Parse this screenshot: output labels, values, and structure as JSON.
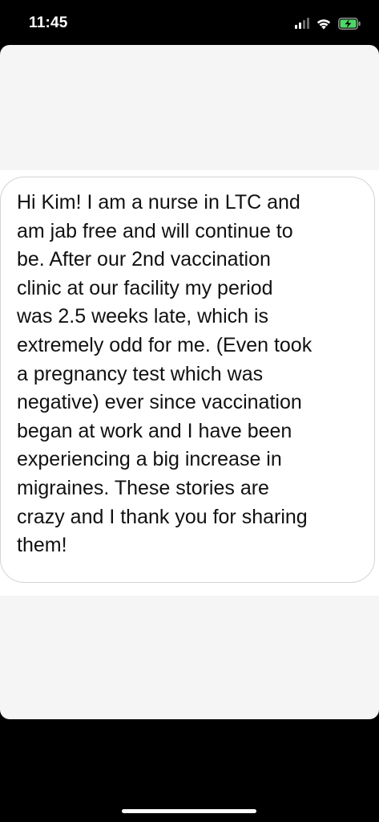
{
  "status_bar": {
    "time": "11:45",
    "icons": [
      "signal-icon",
      "wifi-icon",
      "battery-charging-icon"
    ],
    "battery_color": "#4cd964"
  },
  "message": {
    "text": "Hi Kim! I am a nurse in LTC and\nam jab free and will continue to\nbe. After our 2nd vaccination\nclinic at our facility my period\nwas 2.5 weeks late, which is\nextremely odd for me. (Even took\na pregnancy test which was\nnegative) ever since vaccination\nbegan at work and I have been\nexperiencing a big increase in\nmigraines. These stories are\ncrazy and I thank you for sharing\nthem!"
  }
}
